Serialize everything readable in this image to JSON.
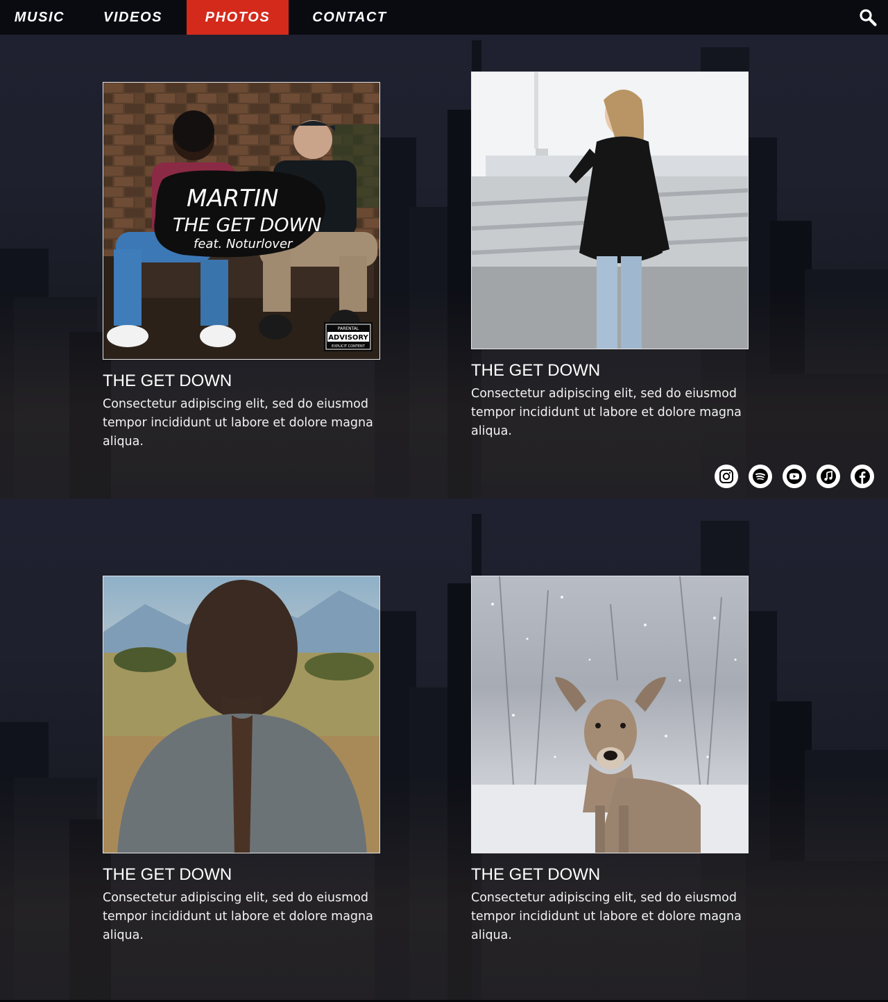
{
  "nav": {
    "items": [
      {
        "label": "MUSIC",
        "active": false
      },
      {
        "label": "VIDEOS",
        "active": false
      },
      {
        "label": "PHOTOS",
        "active": true
      },
      {
        "label": "CONTACT",
        "active": false
      }
    ],
    "search_icon": "search-icon"
  },
  "colors": {
    "nav_bg": "#0a0b11",
    "accent": "#d42a1c",
    "text": "#ffffff"
  },
  "album": {
    "artist": "MARTIN",
    "song": "THE GET DOWN",
    "feat": "feat. Noturlover",
    "badge_top": "PARENTAL",
    "badge_main": "ADVISORY",
    "badge_bottom": "EXPLICIT CONTENT"
  },
  "cards": [
    {
      "title": "THE GET DOWN",
      "text": "Consectetur adipiscing elit, sed do eiusmod tempor incididunt ut labore et dolore magna aliqua.",
      "image": "album-cover-two-men"
    },
    {
      "title": "THE GET DOWN",
      "text": "Consectetur adipiscing elit, sed do eiusmod tempor incididunt ut labore et dolore magna aliqua.",
      "image": "woman-black-sweater"
    },
    {
      "title": "THE GET DOWN",
      "text": "Consectetur adipiscing elit, sed do eiusmod tempor incididunt ut labore et dolore magna aliqua.",
      "image": "woman-braid-back"
    },
    {
      "title": "THE GET DOWN",
      "text": "Consectetur adipiscing elit, sed do eiusmod tempor incididunt ut labore et dolore magna aliqua.",
      "image": "deer-in-snow"
    }
  ],
  "socials": [
    {
      "icon": "instagram-icon"
    },
    {
      "icon": "spotify-icon"
    },
    {
      "icon": "youtube-icon"
    },
    {
      "icon": "apple-music-icon"
    },
    {
      "icon": "facebook-icon"
    }
  ]
}
